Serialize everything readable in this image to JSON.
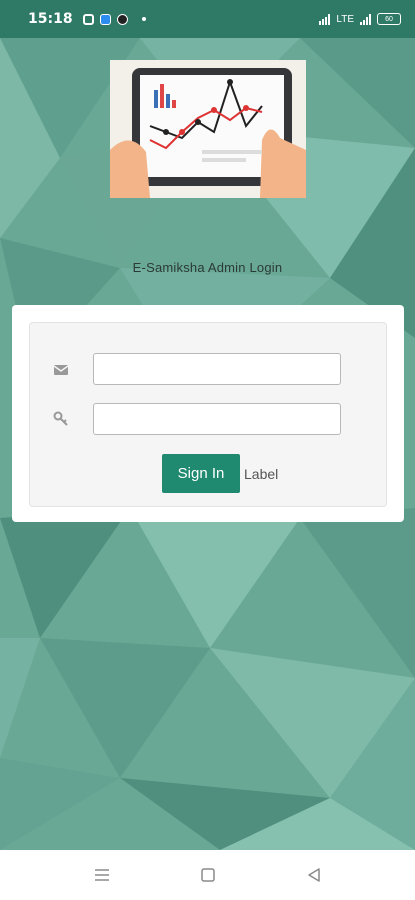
{
  "status_bar": {
    "time": "15:18",
    "network": "LTE",
    "battery": "60"
  },
  "app": {
    "title": "E-Samiksha Admin Login"
  },
  "login_form": {
    "email_placeholder": "",
    "email_value": "",
    "password_placeholder": "",
    "password_value": "",
    "signin_label": "Sign In",
    "extra_label": "Label"
  },
  "icons": {
    "email": "envelope-icon",
    "password": "key-icon",
    "nav_menu": "menu-icon",
    "nav_home": "square-home-icon",
    "nav_back": "triangle-back-icon"
  },
  "colors": {
    "status_bar": "#2f7a66",
    "background": "#6aa896",
    "primary_button": "#1f8a6f"
  }
}
